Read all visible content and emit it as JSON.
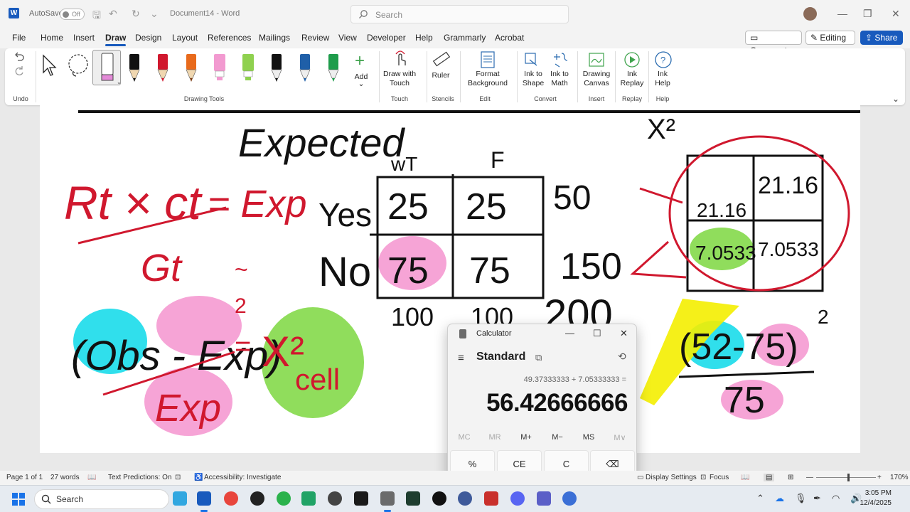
{
  "titlebar": {
    "autosave_label": "AutoSave",
    "autosave_state": "Off",
    "document_name": "Document14 - Word",
    "search_placeholder": "Search"
  },
  "menu": {
    "tabs": [
      "File",
      "Home",
      "Insert",
      "Draw",
      "Design",
      "Layout",
      "References",
      "Mailings",
      "Review",
      "View",
      "Developer",
      "Help",
      "Grammarly",
      "Acrobat"
    ],
    "active_tab": "Draw",
    "comments_label": "Comments",
    "editing_label": "Editing",
    "share_label": "Share"
  },
  "ribbon": {
    "groups": {
      "undo": "Undo",
      "drawing_tools": "Drawing Tools",
      "touch": "Touch",
      "stencils": "Stencils",
      "edit": "Edit",
      "convert": "Convert",
      "insert": "Insert",
      "replay": "Replay",
      "help": "Help"
    },
    "add_label": "Add",
    "draw_with_touch": "Draw with Touch",
    "ruler": "Ruler",
    "format_background": "Format Background",
    "ink_to_shape": "Ink to Shape",
    "ink_to_math": "Ink to Math",
    "drawing_canvas": "Drawing Canvas",
    "ink_replay": "Ink Replay",
    "ink_help": "Ink Help",
    "pen_colors": [
      "#111111",
      "#d0182e",
      "#e86a1c",
      "#f29ad0",
      "#8fd14f",
      "#111111",
      "#1f5fa8",
      "#1e9c4b"
    ]
  },
  "ink": {
    "title": "Expected",
    "chi_sq_label": "X²",
    "col_headers": [
      "wT",
      "F"
    ],
    "row_labels": [
      "Yes",
      "No"
    ],
    "cells": [
      "25",
      "25",
      "75",
      "75"
    ],
    "row_totals": [
      "50",
      "150"
    ],
    "col_totals": [
      "100",
      "100"
    ],
    "grand_total": "200",
    "formula_num": "Rt × ct",
    "formula_eq": "= Exp",
    "formula_den": "Gt",
    "obs_text": "(Obs - Exp)",
    "sq": "2",
    "exp_text": "Exp",
    "chi_cell": "X²",
    "cell_text": "cell",
    "result_cells": [
      "21.16",
      "21.16",
      "7.0533",
      "7.0533"
    ],
    "calc_num": "(52-75)",
    "calc_den": "75"
  },
  "calculator": {
    "title": "Calculator",
    "mode": "Standard",
    "expression": "49.37333333 + 7.05333333 =",
    "result": "56.42666666",
    "memory_buttons": [
      "MC",
      "MR",
      "M+",
      "M−",
      "MS",
      "M∨"
    ],
    "keys": [
      "%",
      "CE",
      "C",
      "⌫"
    ]
  },
  "statusbar": {
    "page": "Page 1 of 1",
    "words": "27 words",
    "text_predictions": "Text Predictions: On",
    "accessibility": "Accessibility: Investigate",
    "display_settings": "Display Settings",
    "focus": "Focus",
    "zoom": "170%"
  },
  "taskbar": {
    "search_placeholder": "Search",
    "time": "3:05 PM",
    "date": "12/4/2025"
  }
}
